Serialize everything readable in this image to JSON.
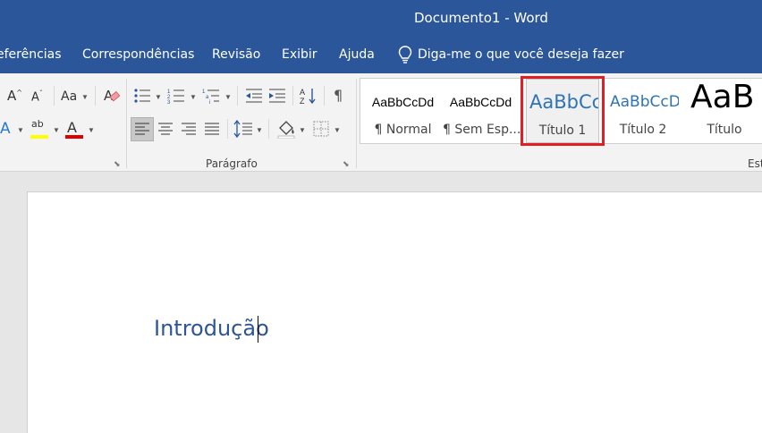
{
  "window": {
    "title": "Documento1  -  Word"
  },
  "menu": {
    "items": [
      "eferências",
      "Correspondências",
      "Revisão",
      "Exibir",
      "Ajuda"
    ],
    "tell_me": "Diga-me o que você deseja fazer"
  },
  "ribbon": {
    "font": {
      "case_label": "Aa",
      "highlight_glyph": "ab",
      "font_color_glyph": "A",
      "effects_glyph": "A"
    },
    "paragraph": {
      "group_label": "Parágrafo",
      "pilcrow": "¶"
    },
    "styles": {
      "group_label_partial": "Est",
      "items": [
        {
          "preview": "AaBbCcDd",
          "name": "¶ Normal"
        },
        {
          "preview": "AaBbCcDd",
          "name": "¶ Sem Esp..."
        },
        {
          "preview": "AaBbCc",
          "name": "Título 1"
        },
        {
          "preview": "AaBbCcD",
          "name": "Título 2"
        },
        {
          "preview": "AaB",
          "name": "Título"
        }
      ]
    }
  },
  "document": {
    "text": "Introdução"
  },
  "colors": {
    "title_bar": "#2b579a",
    "highlight_box": "#e01e26",
    "heading_text": "#2e5596",
    "highlight_yellow": "#ffff00",
    "font_red": "#e00000"
  }
}
